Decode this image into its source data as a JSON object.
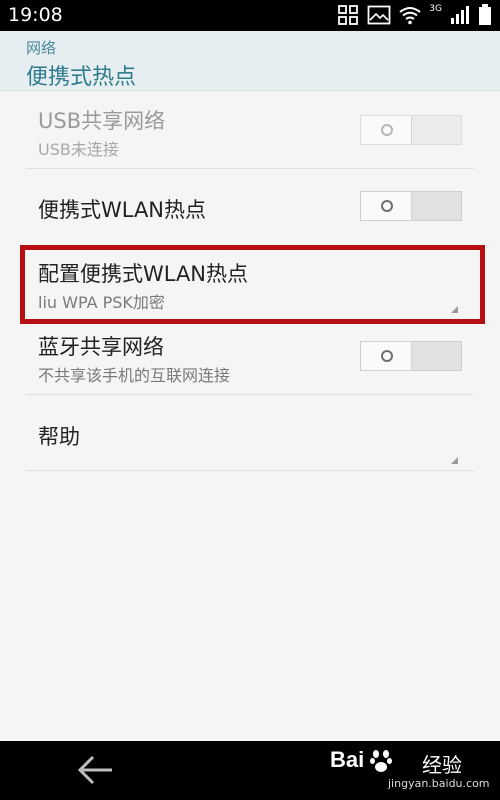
{
  "status_bar": {
    "time": "19:08",
    "network_label": "3G"
  },
  "header": {
    "parent": "网络",
    "title": "便携式热点"
  },
  "settings": [
    {
      "title": "USB共享网络",
      "subtitle": "USB未连接",
      "toggle": "off",
      "enabled": false
    },
    {
      "title": "便携式WLAN热点",
      "toggle": "off",
      "enabled": true
    },
    {
      "title": "配置便携式WLAN热点",
      "subtitle": "liu WPA PSK加密",
      "highlighted": true
    },
    {
      "title": "蓝牙共享网络",
      "subtitle": "不共享该手机的互联网连接",
      "toggle": "off",
      "enabled": true
    },
    {
      "title": "帮助"
    }
  ],
  "watermark": {
    "brand": "Bai",
    "brand_suffix": "经验",
    "url": "jingyan.baidu.com"
  },
  "colors": {
    "accent": "#2f7c8d",
    "highlight": "#b60f12"
  }
}
